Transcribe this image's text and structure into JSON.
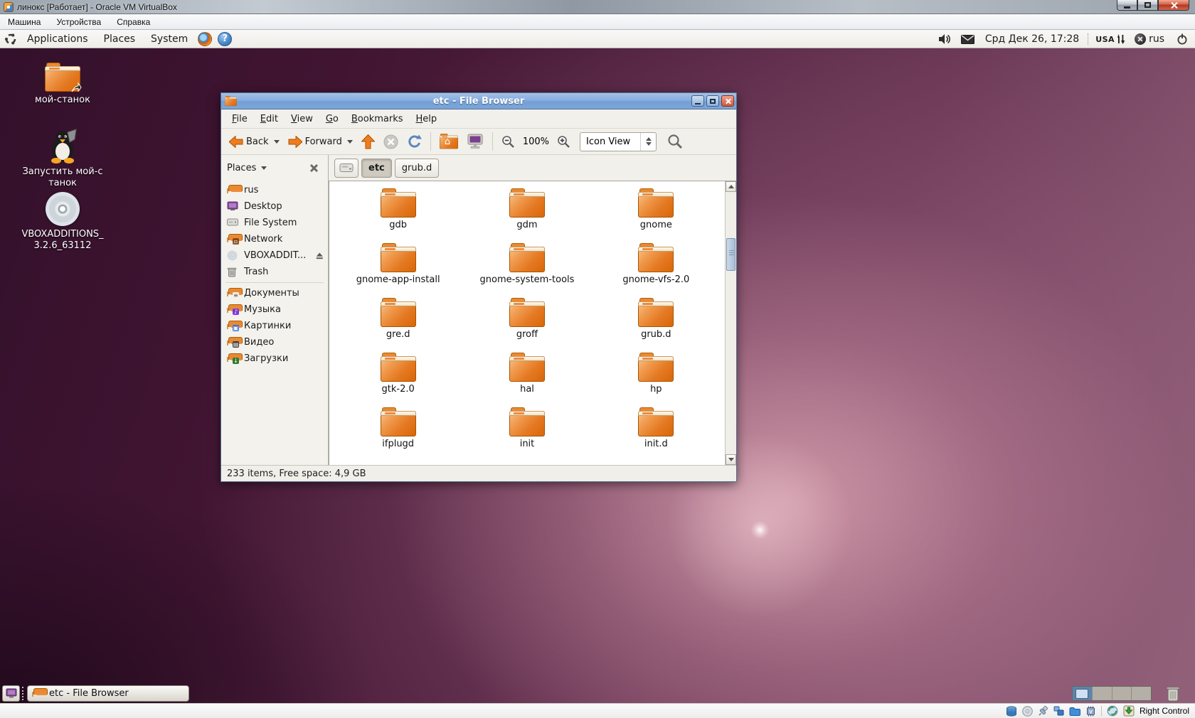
{
  "vbox": {
    "title": "линокс [Работает] - Oracle VM VirtualBox",
    "menu": {
      "machine": "Машина",
      "devices": "Устройства",
      "help": "Справка"
    },
    "status": {
      "host_key_label": "Right Control"
    }
  },
  "panel": {
    "applications": "Applications",
    "places": "Places",
    "system": "System",
    "help_glyph": "?",
    "clock": "Срд Дек 26, 17:28",
    "layout": "USA",
    "lang": "rus"
  },
  "desktop": {
    "icon1": "мой-станок",
    "icon2": "Запустить мой-станок",
    "icon3": "VBOXADDITIONS_3.2.6_63112"
  },
  "fb": {
    "title": "etc - File Browser",
    "menu": {
      "file": "File",
      "edit": "Edit",
      "view": "View",
      "go": "Go",
      "bookmarks": "Bookmarks",
      "help": "Help"
    },
    "toolbar": {
      "back": "Back",
      "forward": "Forward",
      "zoom": "100%",
      "view_mode": "Icon View"
    },
    "places_header": "Places",
    "path": {
      "etc": "etc",
      "grubd": "grub.d"
    },
    "home_glyph": "⌂",
    "sidebar": [
      "rus",
      "Desktop",
      "File System",
      "Network",
      "VBOXADDIT...",
      "Trash",
      "Документы",
      "Музыка",
      "Картинки",
      "Видео",
      "Загрузки"
    ],
    "folders": [
      "gdb",
      "gdm",
      "gnome",
      "gnome-app-install",
      "gnome-system-tools",
      "gnome-vfs-2.0",
      "gre.d",
      "groff",
      "grub.d",
      "gtk-2.0",
      "hal",
      "hp",
      "ifplugd",
      "init",
      "init.d"
    ],
    "status": "233 items, Free space: 4,9 GB"
  },
  "taskbar": {
    "task": "etc - File Browser"
  },
  "colors": {
    "folder_orange": "#e8701e",
    "titlebar_blue": "#7ba6d8",
    "desktop_purple": "#50203f",
    "panel_bg": "#f4f2ee",
    "close_red": "#cd5a3d"
  }
}
